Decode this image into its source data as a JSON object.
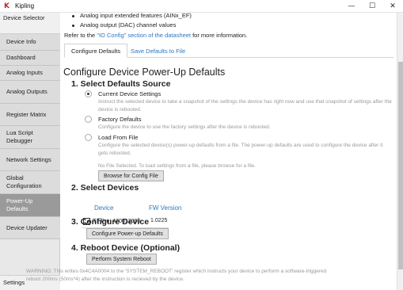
{
  "window": {
    "title": "Kipling",
    "minimize": "—",
    "maximize": "☐",
    "close": "✕"
  },
  "sidebar": {
    "header": "Device Selector",
    "items": [
      {
        "label": "Device Info",
        "active": false
      },
      {
        "label": "Dashboard",
        "active": false
      },
      {
        "label": "Analog Inputs",
        "active": false
      },
      {
        "label": "Analog Outputs",
        "active": false
      },
      {
        "label": "Register Matrix",
        "active": false
      },
      {
        "label": "Lua Script Debugger",
        "active": false
      },
      {
        "label": "Network Settings",
        "active": false
      },
      {
        "label": "Global Configuration",
        "active": false
      },
      {
        "label": "Power-Up Defaults",
        "active": true
      },
      {
        "label": "Device Updater",
        "active": false
      }
    ],
    "footer": "Settings"
  },
  "intro": {
    "bullets": [
      "Analog input extended features (AINx_EF)",
      "Analog output (DAC) channel values"
    ],
    "refer_prefix": "Refer to the ",
    "refer_link": "\"IO Config\" section of the datasheet",
    "refer_suffix": " for more information."
  },
  "tabs": [
    {
      "label": "Configure Defaults",
      "active": true
    },
    {
      "label": "Save Defaults to File",
      "active": false
    }
  ],
  "page_title": "Configure Device Power-Up Defaults",
  "step1": {
    "title": "1. Select Defaults Source",
    "options": [
      {
        "label": "Current Device Settings",
        "selected": true,
        "description": "Instruct the selected device to take a snapshot of the settings the device has right now and use that snapshot of settings after the device is rebooted."
      },
      {
        "label": "Factory Defaults",
        "selected": false,
        "description": "Configure the device to use the factory settings after the device is rebooted."
      },
      {
        "label": "Load From File",
        "selected": false,
        "description": "Configure the selected device(s) power-up defaults from a file. The power-up defaults are used to configure the device after it gets rebooted."
      }
    ],
    "no_file_text": "No File Selected. To load settings from a file, please browse for a file.",
    "browse_button": "Browse for Config File"
  },
  "step2": {
    "title": "2. Select Devices",
    "col_device": "Device",
    "col_fw": "FW Version",
    "devices": [
      {
        "name": "T7-Pro: 470012090",
        "fw": "1.0225",
        "checked": true
      }
    ]
  },
  "step3": {
    "title": "3. Configure Device",
    "button": "Configure Power-up Defaults"
  },
  "step4": {
    "title": "4. Reboot Device (Optional)",
    "button": "Perform System Reboot",
    "warning": "WARNING: This writes 0x4C4A0004 to the 'SYSTEM_REBOOT' register which instructs your device to perform a software-triggered reboot 200ms (50ms*4) after the instruction is recieved by the device."
  },
  "colors": {
    "accent_link": "#2a78c2",
    "active_sidebar": "#9a9a9a",
    "app_icon": "#c0282d"
  }
}
